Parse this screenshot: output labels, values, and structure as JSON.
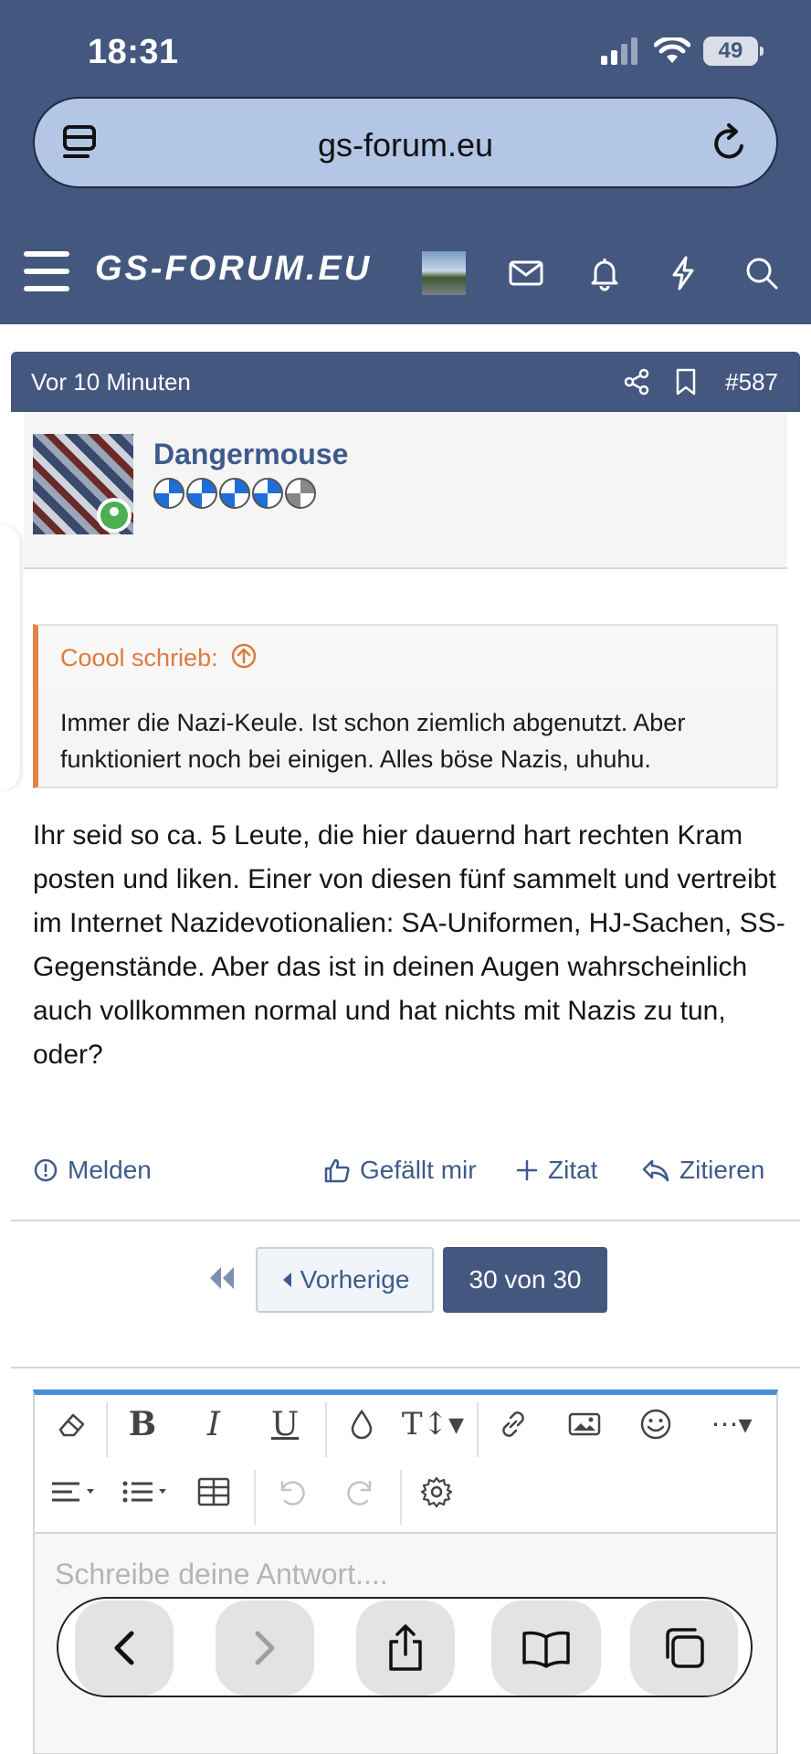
{
  "status_bar": {
    "time": "18:31",
    "battery": "49"
  },
  "browser": {
    "url": "gs-forum.eu"
  },
  "site": {
    "logo": "GS-FORUM.EU"
  },
  "post": {
    "time": "Vor 10 Minuten",
    "number": "#587",
    "username": "Dangermouse",
    "quote": {
      "author": "Coool schrieb:",
      "text": "Immer die Nazi-Keule. Ist schon ziemlich abgenutzt. Aber funktioniert noch bei einigen. Alles böse Nazis, uhuhu."
    },
    "body": "Ihr seid so ca. 5 Leute, die hier dauernd hart rechten Kram posten und liken. Einer von diesen fünf sammelt und vertreibt im Internet Nazidevotionalien: SA-Uniformen, HJ-Sachen, SS-Gegenstände. Aber das ist in deinen Augen wahrscheinlich auch vollkommen normal und hat nichts mit Nazis zu tun, oder?",
    "actions": {
      "report": "Melden",
      "like": "Gefällt mir",
      "multiquote": "Zitat",
      "reply": "Zitieren"
    }
  },
  "pagination": {
    "prev": "Vorherige",
    "current": "30 von 30"
  },
  "editor": {
    "placeholder": "Schreibe deine Antwort...."
  },
  "colors": {
    "brand": "#43577f",
    "link": "#3f5a8a",
    "quote_accent": "#e08448",
    "editor_accent": "#4a8fd9"
  }
}
